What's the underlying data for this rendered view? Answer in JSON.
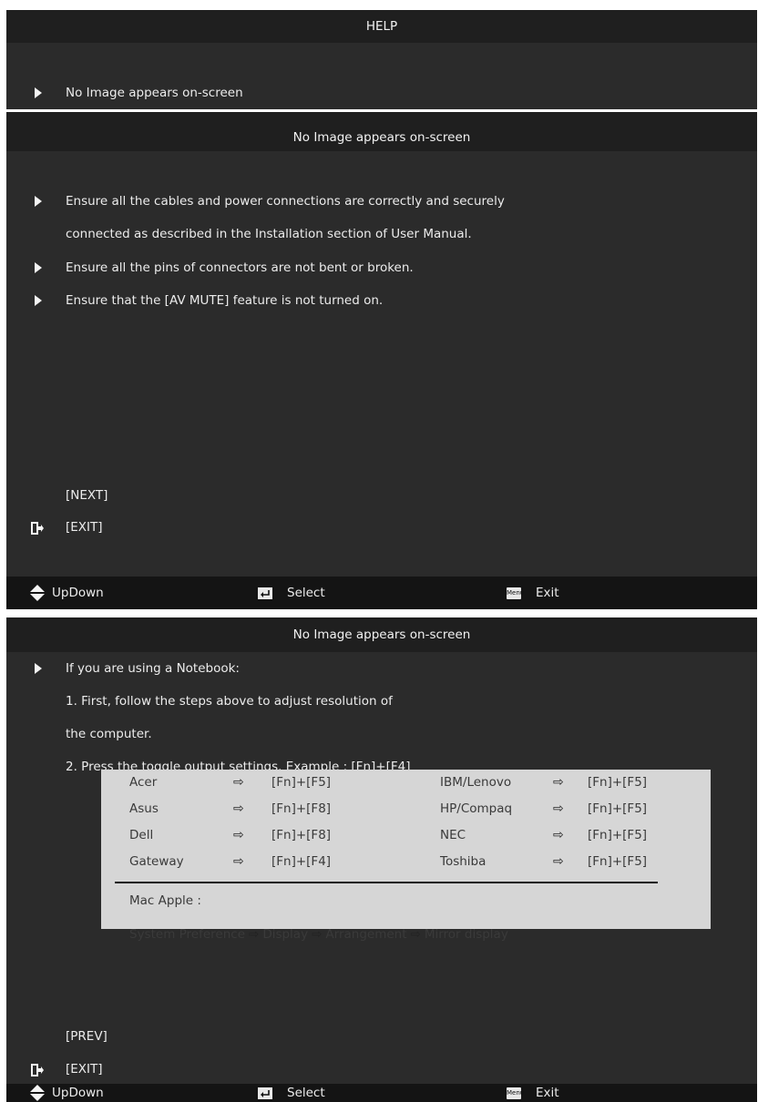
{
  "help": {
    "title": "HELP",
    "item": "No Image appears on-screen"
  },
  "screen1": {
    "title": "No Image appears on-screen",
    "bullet1_line1": "Ensure all the cables and power connections are correctly and securely",
    "bullet1_line2": "connected as described in the Installation section of User Manual.",
    "bullet2": "Ensure all the pins of connectors are not bent or broken.",
    "bullet3": "Ensure that the [AV MUTE] feature is not turned on.",
    "next": "[NEXT]",
    "exit": "[EXIT]"
  },
  "screen2": {
    "title": "No Image appears on-screen",
    "intro": "If you are using a Notebook:",
    "step1_line1": "1. First, follow the steps above to adjust resolution of",
    "step1_line2": "the computer.",
    "step2": "2. Press the toggle output settings. Example : [Fn]+[F4]",
    "table": {
      "rows": [
        {
          "brand1": "Acer",
          "key1": "[Fn]+[F5]",
          "brand2": "IBM/Lenovo",
          "key2": "[Fn]+[F5]"
        },
        {
          "brand1": "Asus",
          "key1": "[Fn]+[F8]",
          "brand2": "HP/Compaq",
          "key2": "[Fn]+[F5]"
        },
        {
          "brand1": "Dell",
          "key1": "[Fn]+[F8]",
          "brand2": "NEC",
          "key2": "[Fn]+[F5]"
        },
        {
          "brand1": "Gateway",
          "key1": "[Fn]+[F4]",
          "brand2": "Toshiba",
          "key2": "[Fn]+[F5]"
        }
      ],
      "arrow": "⇨",
      "mac_label": "Mac Apple :",
      "mac_path": [
        "System Preference",
        "Display",
        "Arrangement",
        "Mirror display"
      ]
    },
    "prev": "[PREV]",
    "exit": "[EXIT]"
  },
  "footer": {
    "updown": "UpDown",
    "select": "Select",
    "menu_key": "Menu",
    "exit": "Exit"
  },
  "colors": {
    "panel": "#2b2b2b",
    "header": "#1f1f1f",
    "footer": "#141414",
    "table": "#d6d6d6"
  }
}
